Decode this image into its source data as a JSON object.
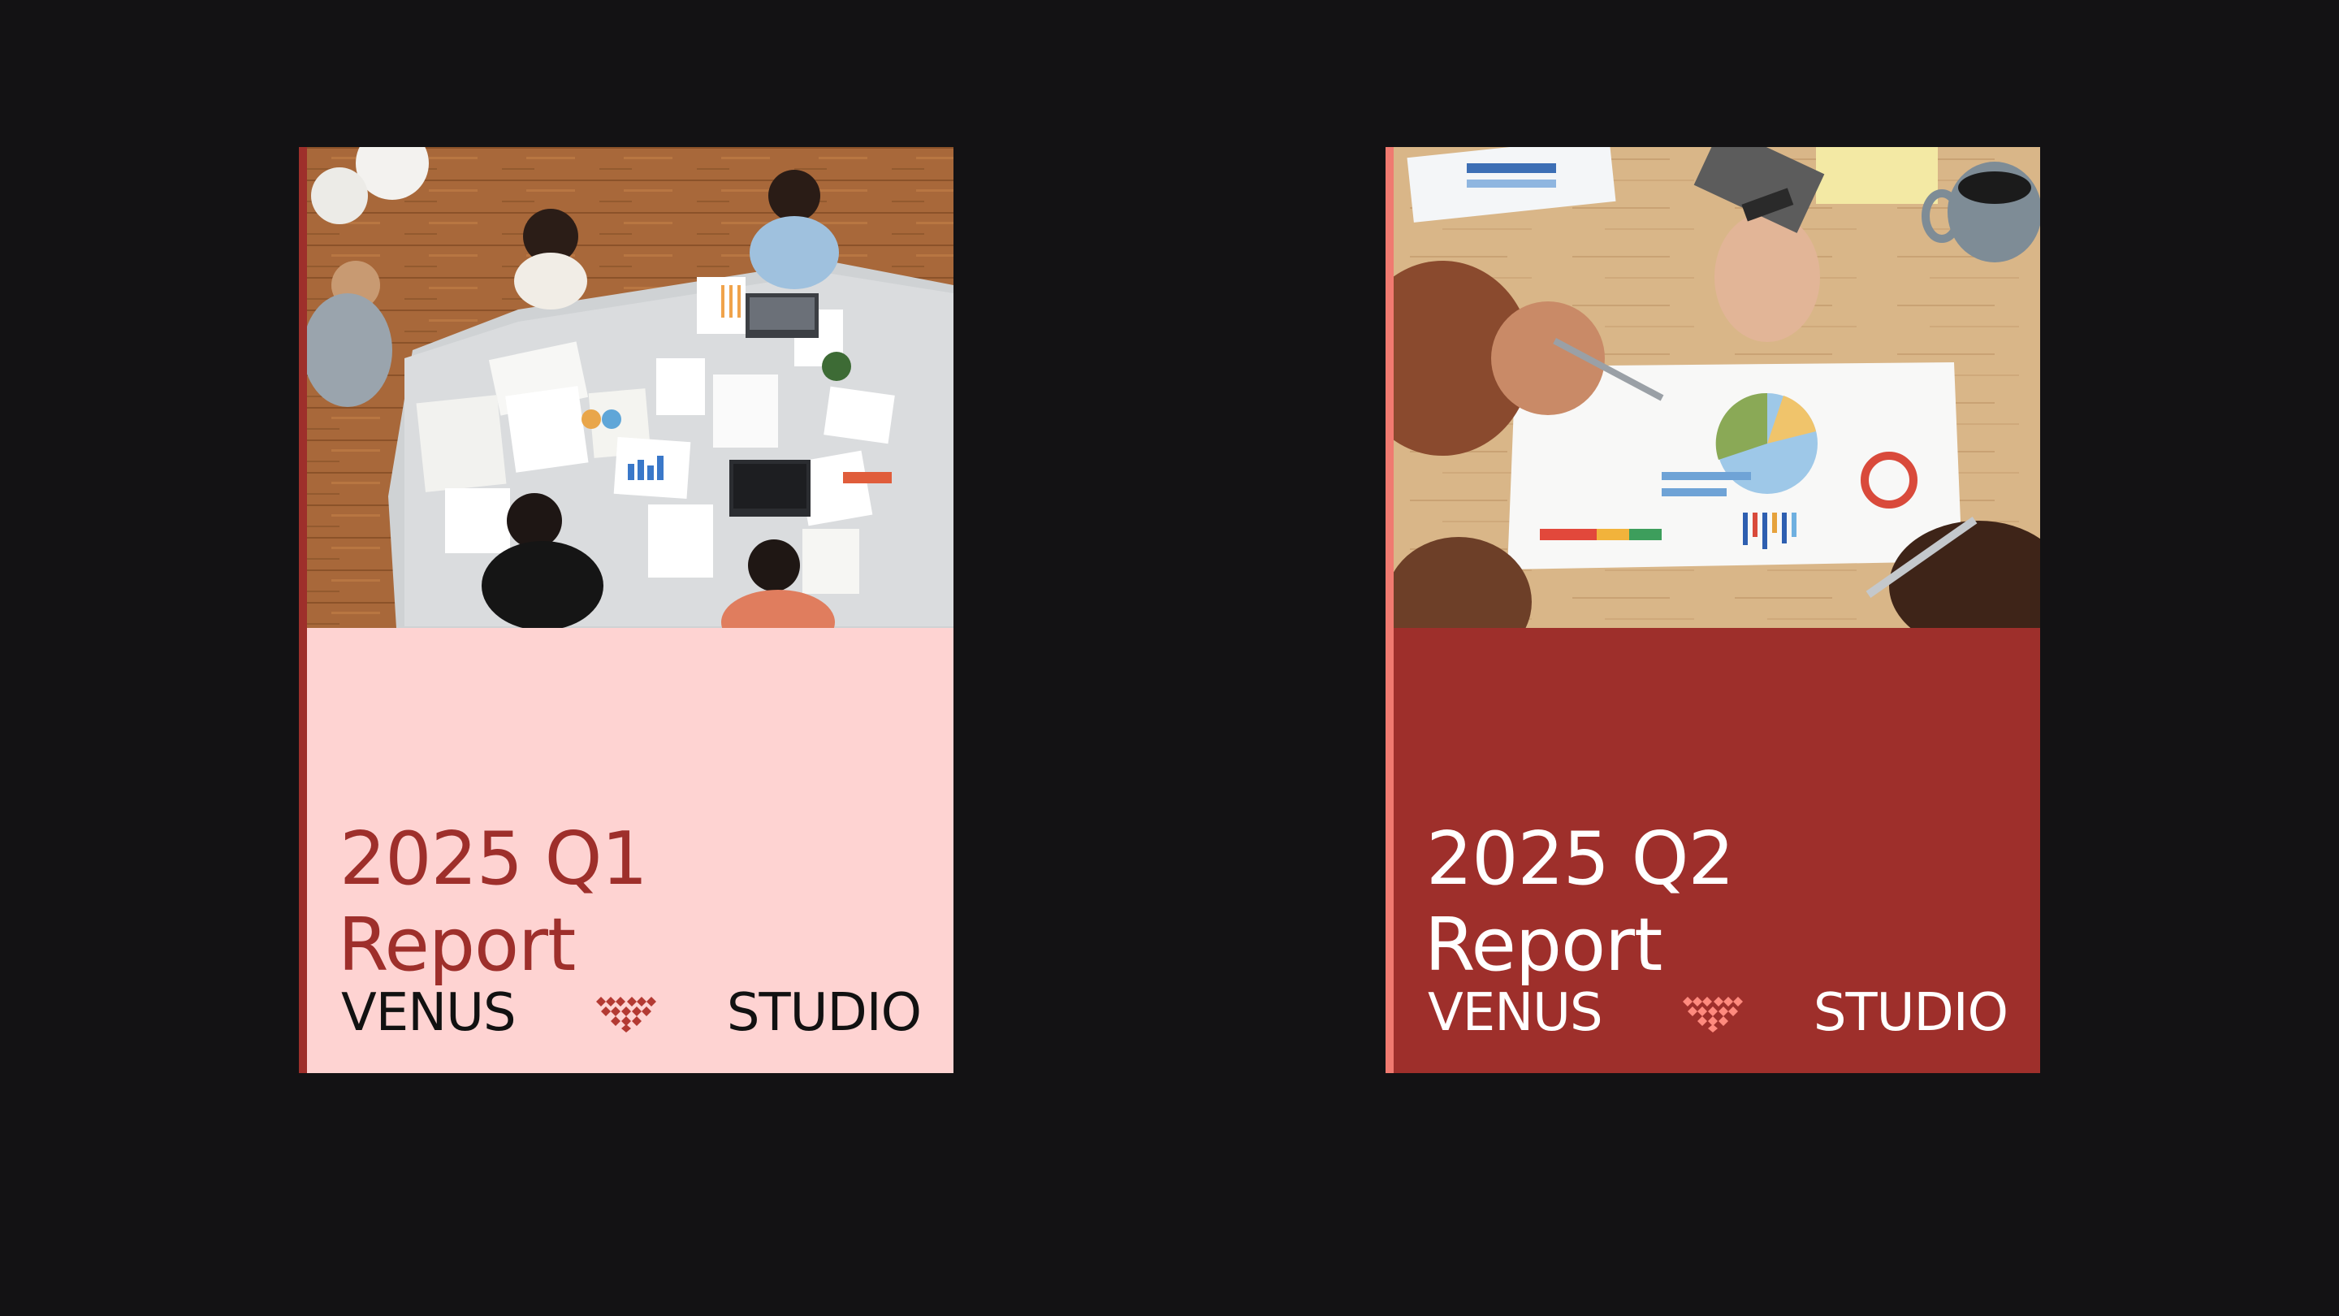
{
  "colors": {
    "background": "#131214",
    "q1_panel": "#fed3d2",
    "q1_spine": "#9e2f2b",
    "q1_title": "#9e2f2b",
    "q1_footer_text": "#111111",
    "q1_logo": "#b33a33",
    "q2_panel": "#9e2f2b",
    "q2_spine": "#f07a70",
    "q2_title": "#ffffff",
    "q2_footer_text": "#ffffff",
    "q2_logo": "#ff8a7e"
  },
  "cards": [
    {
      "title_year_quarter": "2025 Q1",
      "title_word": "Report",
      "footer_left": "VENUS",
      "footer_right": "STUDIO",
      "logo_icon": "diamond-grid-logo-icon",
      "photo": "overhead-team-meeting-photo"
    },
    {
      "title_year_quarter": "2025 Q2",
      "title_word": "Report",
      "footer_left": "VENUS",
      "footer_right": "STUDIO",
      "logo_icon": "diamond-grid-logo-icon",
      "photo": "hands-pointing-at-charts-photo"
    }
  ]
}
